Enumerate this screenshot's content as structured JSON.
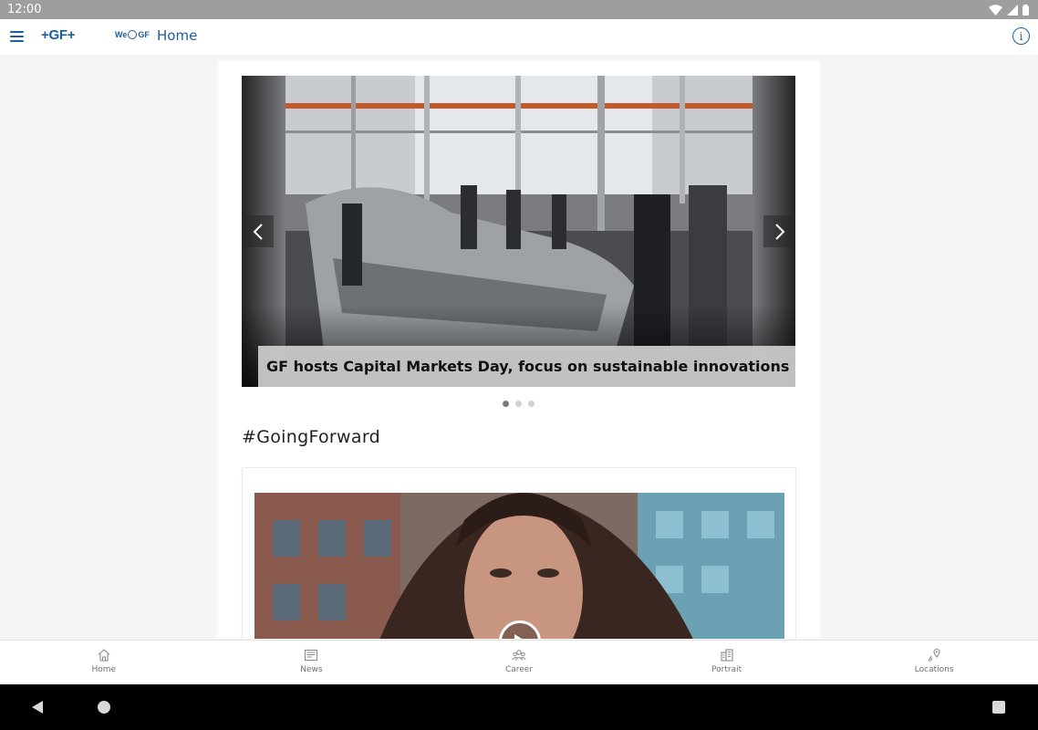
{
  "status_bar": {
    "time": "12:00"
  },
  "app_bar": {
    "brand_logo": "+GF+",
    "sub_logo_left": "We",
    "sub_logo_right": "GF",
    "title": "Home"
  },
  "carousel": {
    "slides": [
      {
        "caption": "GF hosts Capital Markets Day, focus on sustainable innovations"
      }
    ],
    "total_slides": 3,
    "active_index": 0
  },
  "section": {
    "heading": "#GoingForward"
  },
  "bottom_nav": {
    "items": [
      {
        "label": "Home",
        "icon": "home-icon"
      },
      {
        "label": "News",
        "icon": "news-icon"
      },
      {
        "label": "Career",
        "icon": "career-icon"
      },
      {
        "label": "Portrait",
        "icon": "portrait-icon"
      },
      {
        "label": "Locations",
        "icon": "location-icon"
      }
    ]
  },
  "colors": {
    "brand_blue": "#1a5f9e",
    "status_bar": "#9e9e9e",
    "page_bg": "#f5f5f5"
  }
}
